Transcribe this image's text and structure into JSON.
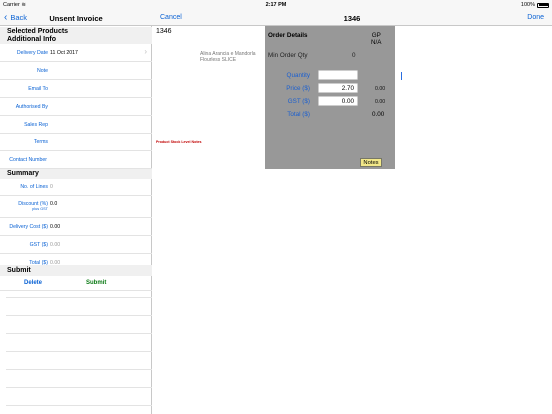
{
  "status_bar": {
    "carrier": "Carrier",
    "time": "2:17 PM",
    "battery": "100%"
  },
  "left_nav": {
    "back_label": "Back",
    "title": "Unsent Invoice"
  },
  "left_sections": {
    "selected_products": "Selected Products",
    "additional_info": "Additional Info",
    "summary": "Summary",
    "submit": "Submit"
  },
  "additional_info": [
    {
      "label": "Delivery Date",
      "value": "11 Oct 2017"
    },
    {
      "label": "Note",
      "value": ""
    },
    {
      "label": "Email To",
      "value": ""
    },
    {
      "label": "Authorised By",
      "value": ""
    },
    {
      "label": "Sales Rep",
      "value": ""
    },
    {
      "label": "Terms",
      "value": ""
    },
    {
      "label": "Contact Number",
      "value": ""
    }
  ],
  "summary": [
    {
      "label": "No. of Lines",
      "value": "0"
    },
    {
      "label": "Discount (%)",
      "sub": "plus GST",
      "value": "0.0"
    },
    {
      "label": "Delivery Cost ($)",
      "value": "0.00"
    },
    {
      "label": "GST ($)",
      "value": "0.00"
    },
    {
      "label": "Total ($)",
      "value": "0.00"
    }
  ],
  "submit": {
    "delete_label": "Delete",
    "submit_label": "Submit"
  },
  "right_nav": {
    "cancel_label": "Cancel",
    "title": "1346",
    "done_label": "Done"
  },
  "product": {
    "code": "1346",
    "description": "Alina Arancia e Mandorla Flourless SLICE",
    "stock_notes_label": "Product Stock Level Notes"
  },
  "order_details": {
    "title": "Order Details",
    "gp_label": "GP",
    "gp_value": "N/A",
    "min_order_qty_label": "Min Order Qty",
    "min_order_qty_value": "0",
    "quantity_label": "Quantity",
    "quantity_value": "",
    "price_label": "Price ($)",
    "price_value": "2.70",
    "price_extra": "0.00",
    "gst_label": "GST ($)",
    "gst_value": "0.00",
    "gst_extra": "0.00",
    "total_label": "Total ($)",
    "total_value": "0.00",
    "notes_label": "Notes"
  },
  "colors": {
    "accent": "#0a62d4",
    "panel_bg": "#989898",
    "delete": "#0a62d4",
    "submit": "#0a7a14",
    "stock_notes": "#c00000",
    "notes_button": "#f2e889"
  }
}
